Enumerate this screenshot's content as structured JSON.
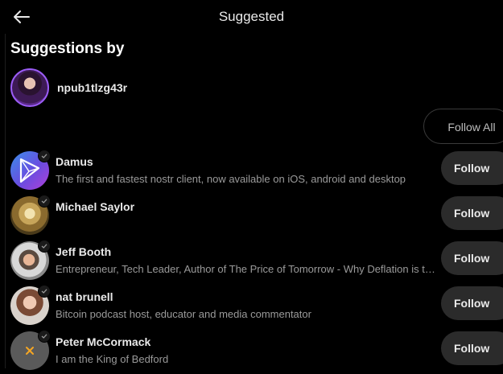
{
  "header": {
    "title": "Suggested"
  },
  "section": {
    "title": "Suggestions by"
  },
  "author": {
    "name": "npub1tlzg43r"
  },
  "follow_all_label": "Follow All",
  "follow_label": "Follow",
  "accent_color": "#9b5cf6",
  "users": [
    {
      "name": "Damus",
      "bio": "The first and fastest nostr client, now available on iOS, android and desktop"
    },
    {
      "name": "Michael Saylor",
      "bio": ""
    },
    {
      "name": "Jeff Booth",
      "bio": "Entrepreneur, Tech Leader, Author of The Price of Tomorrow - Why Deflation is the Key to an Abundant Future"
    },
    {
      "name": "nat brunell",
      "bio": "Bitcoin podcast host, educator and media commentator"
    },
    {
      "name": "Peter McCormack",
      "bio": "I am the King of Bedford"
    }
  ]
}
